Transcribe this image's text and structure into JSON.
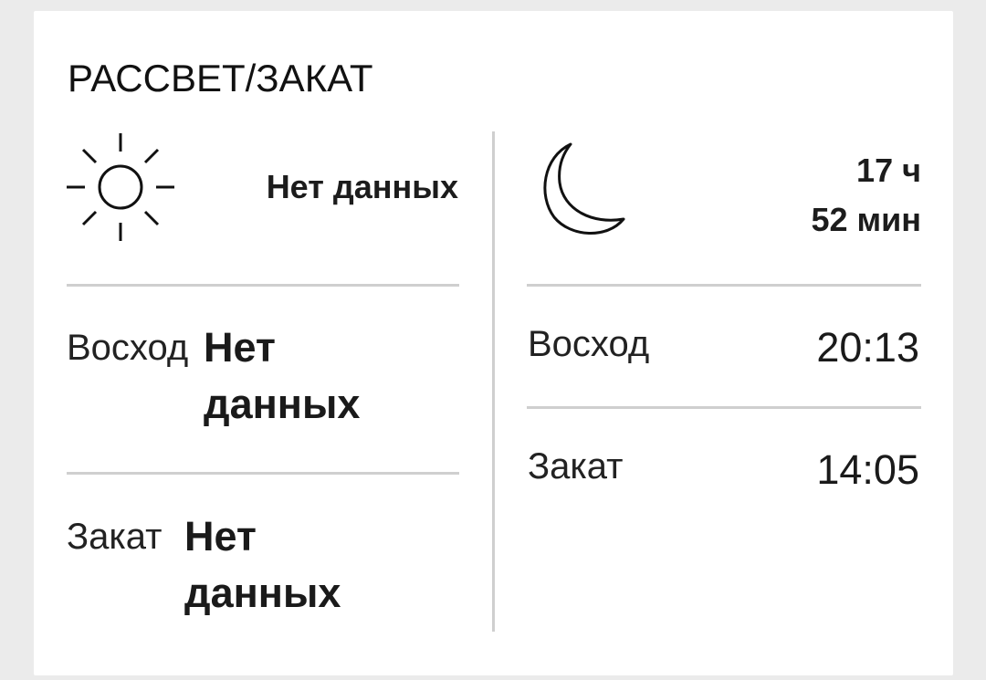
{
  "widget": {
    "title": "РАССВЕТ/ЗАКАТ"
  },
  "sun": {
    "icon": "sun-icon",
    "summary": "Нет данных",
    "rows": [
      {
        "label": "Восход",
        "value": "Нет данных"
      },
      {
        "label": "Закат",
        "value": "Нет данных"
      }
    ]
  },
  "moon": {
    "icon": "moon-icon",
    "duration_hours": "17 ч",
    "duration_minutes": "52 мин",
    "rows": [
      {
        "label": "Восход",
        "value": "20:13"
      },
      {
        "label": "Закат",
        "value": "14:05"
      }
    ]
  },
  "colors": {
    "background": "#ebebeb",
    "card": "#ffffff",
    "divider": "#cfcfcf",
    "text": "#1a1a1a"
  }
}
